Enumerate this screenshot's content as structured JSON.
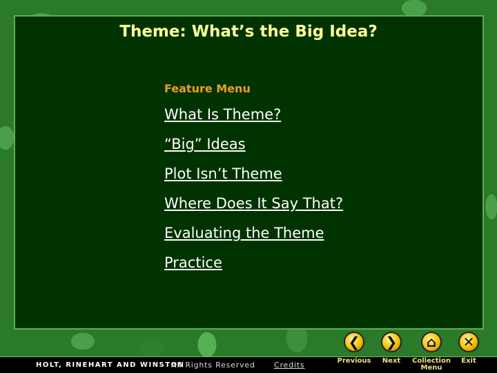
{
  "title": "Theme: What’s the Big Idea?",
  "menu": {
    "heading": "Feature Menu",
    "items": [
      "What Is Theme?",
      "“Big” Ideas",
      "Plot Isn’t Theme",
      "Where Does It Say That?",
      "Evaluating the Theme",
      "Practice"
    ]
  },
  "footer": {
    "brand": "HOLT, RINEHART AND WINSTON",
    "rights": "All Rights Reserved",
    "credits": "Credits"
  },
  "nav": {
    "previous": "Previous",
    "next": "Next",
    "collection": "Collection",
    "menu": "Menu",
    "exit": "Exit",
    "icons": {
      "previous": "chevron-left-icon",
      "next": "chevron-right-icon",
      "collection": "home-icon",
      "exit": "close-icon"
    }
  },
  "colors": {
    "panel": "#003300",
    "title": "#ffff99",
    "heading": "#e8a020",
    "button": "#f5c000"
  }
}
